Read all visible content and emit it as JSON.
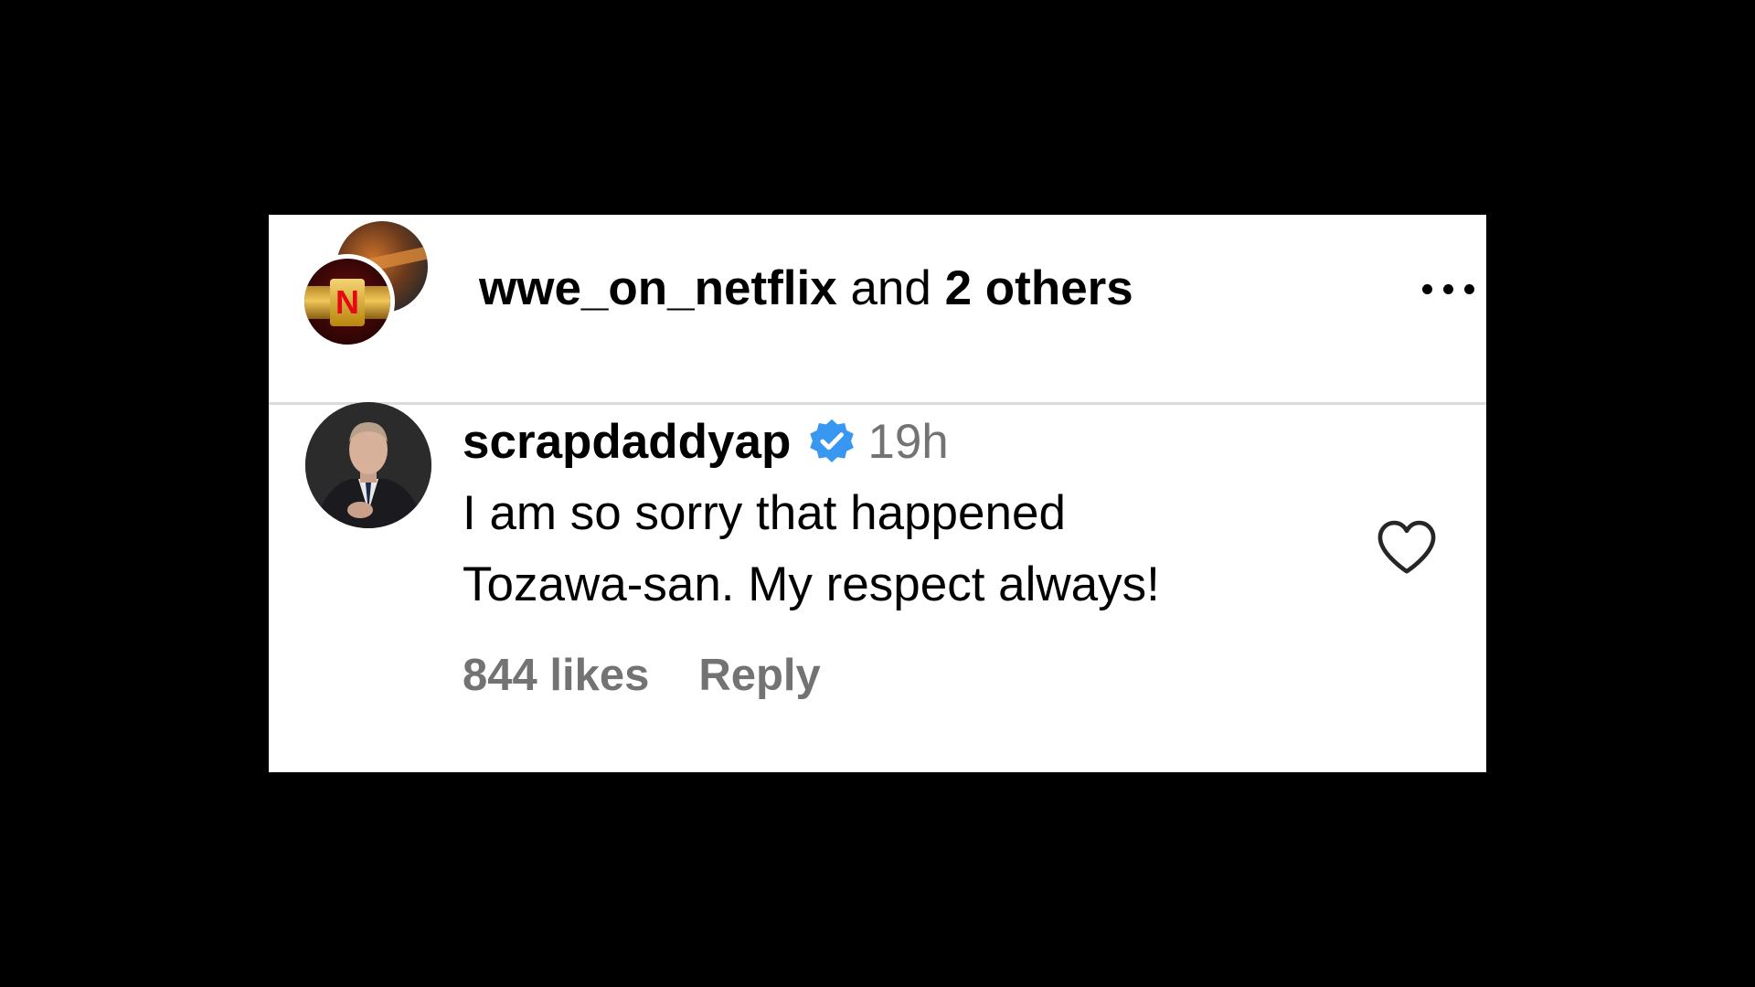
{
  "header": {
    "account_name": "wwe_on_netflix",
    "connector": "and",
    "others": "2 others",
    "avatar_front_letter": "N",
    "more_icon": "more-horizontal-icon"
  },
  "comment": {
    "username": "scrapdaddyap",
    "verified_icon": "verified-badge-icon",
    "timestamp": "19h",
    "text_line1": "I am so sorry that happened",
    "text_line2": "Tozawa-san. My respect always!",
    "likes": "844 likes",
    "reply_label": "Reply",
    "like_icon": "heart-outline-icon"
  },
  "colors": {
    "background": "#000000",
    "card": "#ffffff",
    "verified_blue": "#3897f0",
    "secondary_text": "#737373",
    "divider": "#dbdbdb",
    "netflix_red": "#e50914"
  }
}
